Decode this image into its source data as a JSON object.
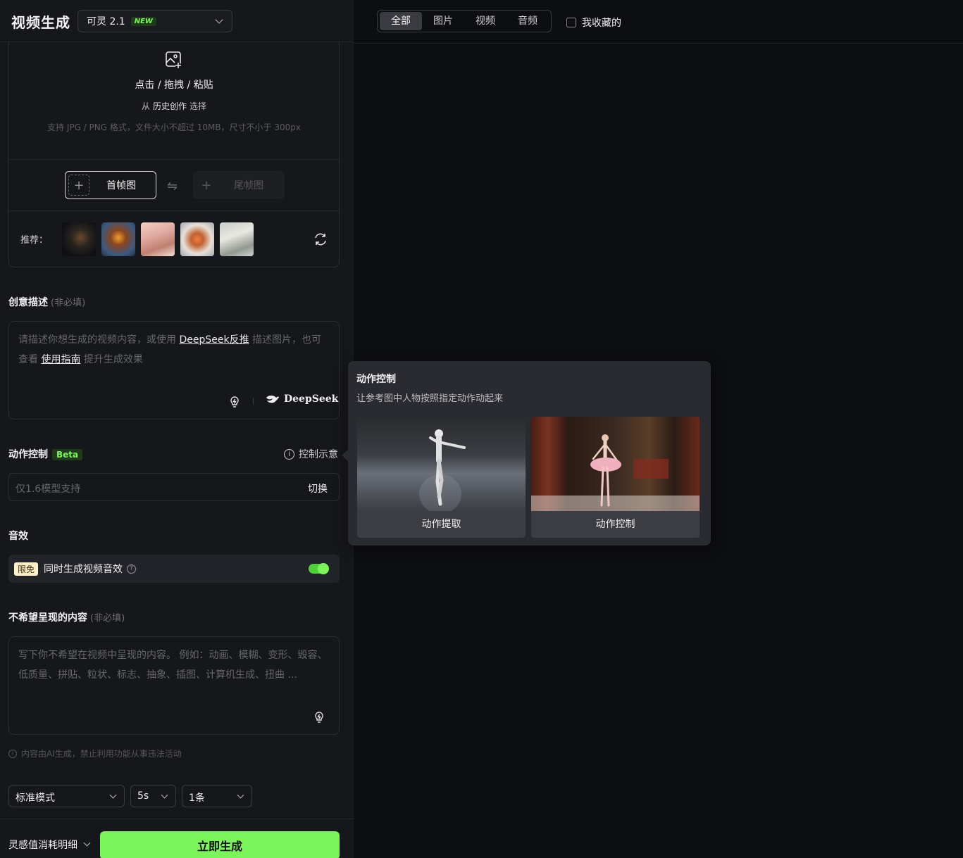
{
  "header": {
    "title": "视频生成",
    "model": "可灵 2.1",
    "model_badge": "NEW"
  },
  "upload": {
    "main_text": "点击 / 拖拽 / 粘贴",
    "history_prefix": "从",
    "history_link": "历史创作",
    "history_suffix": "选择",
    "hint": "支持 JPG / PNG 格式，文件大小不超过 10MB，尺寸不小于 300px",
    "first_frame": "首帧图",
    "last_frame": "尾帧图",
    "recommend_label": "推荐："
  },
  "prompt": {
    "title": "创意描述",
    "optional": "(非必填)",
    "placeholder_1": "请描述你想生成的视频内容，或使用",
    "link_deepseek": "DeepSeek反推",
    "placeholder_2": "描述图片，也可查看",
    "link_guide": "使用指南",
    "placeholder_3": "提升生成效果",
    "deepseek_label": "DeepSeek"
  },
  "motion": {
    "title": "动作控制",
    "badge": "Beta",
    "demo_label": "控制示意",
    "placeholder": "仅1.6模型支持",
    "switch_label": "切换"
  },
  "sound": {
    "title": "音效",
    "free_badge": "限免",
    "label": "同时生成视频音效",
    "enabled": true
  },
  "negative": {
    "title": "不希望呈现的内容",
    "optional": "(非必填)",
    "placeholder": "写下你不希望在视频中呈现的内容。 例如：动画、模糊、变形、毁容、低质量、拼贴、粒状、标志、抽象、插图、计算机生成、扭曲 ..."
  },
  "disclaimer": "内容由AI生成，禁止利用功能从事违法活动",
  "settings": {
    "mode": "标准模式",
    "duration": "5s",
    "count": "1条"
  },
  "footer": {
    "cost_detail": "灵感值消耗明细",
    "generate": "立即生成"
  },
  "filters": {
    "tabs": [
      "全部",
      "图片",
      "视频",
      "音频"
    ],
    "active": "全部",
    "favorites_label": "我收藏的"
  },
  "popover": {
    "title": "动作控制",
    "description": "让参考图中人物按照指定动作动起来",
    "card_1": "动作提取",
    "card_2": "动作控制"
  },
  "colors": {
    "accent": "#7cf55a",
    "background": "#16171b",
    "popover": "#2a2b30"
  }
}
